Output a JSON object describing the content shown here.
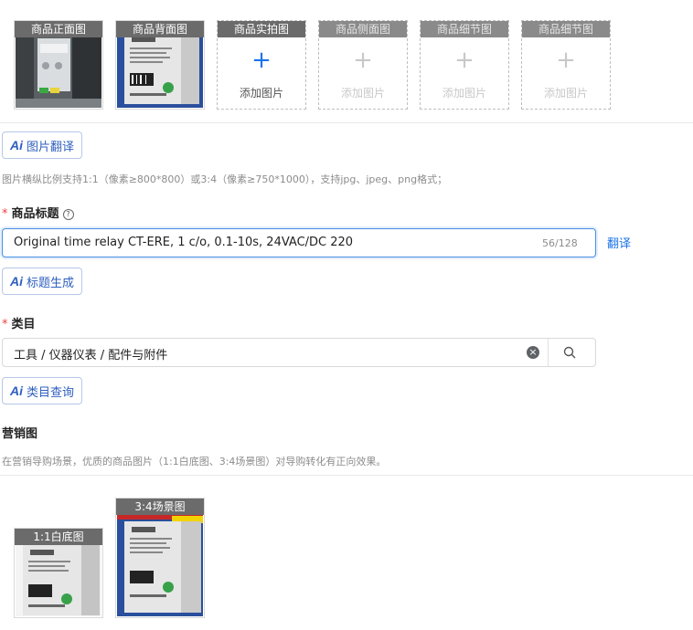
{
  "photo_slots": [
    {
      "caption": "商品正面图",
      "type": "photo"
    },
    {
      "caption": "商品背面图",
      "type": "photo"
    },
    {
      "caption": "商品实拍图",
      "type": "add",
      "add_label": "添加图片",
      "plus": "+"
    },
    {
      "caption": "商品侧面图",
      "type": "add-disabled",
      "add_label": "添加图片",
      "plus": "+"
    },
    {
      "caption": "商品细节图",
      "type": "add-disabled",
      "add_label": "添加图片",
      "plus": "+"
    },
    {
      "caption": "商品细节图",
      "type": "add-disabled",
      "add_label": "添加图片",
      "plus": "+"
    }
  ],
  "ai_translate": {
    "icon": "Ai",
    "label": "图片翻译"
  },
  "image_hint": "图片横纵比例支持1:1（像素≥800*800）或3:4（像素≥750*1000），支持jpg、jpeg、png格式；",
  "title_field": {
    "required_mark": "*",
    "label": "商品标题",
    "help_icon": "?",
    "value": "Original time relay CT-ERE, 1 c/o, 0.1-10s, 24VAC/DC 220",
    "counter": "56/128",
    "translate_link": "翻译"
  },
  "ai_title": {
    "icon": "Ai",
    "label": "标题生成"
  },
  "category_field": {
    "required_mark": "*",
    "label": "类目",
    "value": "工具 / 仪器仪表 / 配件与附件",
    "clear_icon": "×"
  },
  "ai_category": {
    "icon": "Ai",
    "label": "类目查询"
  },
  "marketing": {
    "label": "营销图",
    "hint": "在营销导购场景，优质的商品图片（1:1白底图、3:4场景图）对导购转化有正向效果。",
    "slots": [
      {
        "caption": "1:1白底图"
      },
      {
        "caption": "3:4场景图"
      }
    ]
  },
  "colors": {
    "accent": "#1a73e8",
    "required": "#f04040"
  }
}
